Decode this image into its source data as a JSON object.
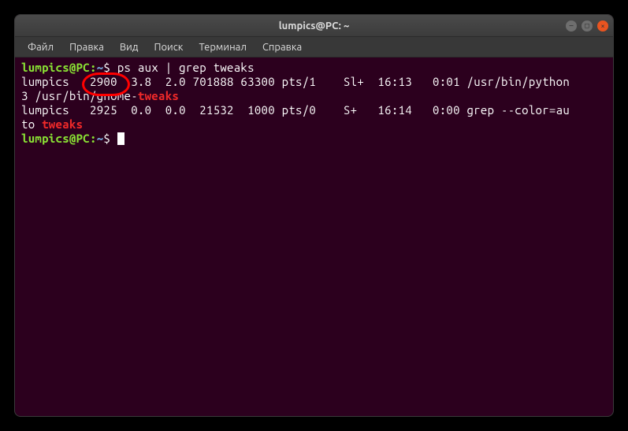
{
  "window": {
    "title": "lumpics@PC: ~"
  },
  "menubar": {
    "items": [
      "Файл",
      "Правка",
      "Вид",
      "Поиск",
      "Терминал",
      "Справка"
    ]
  },
  "prompt": {
    "user_host": "lumpics@PC",
    "separator": ":",
    "path": "~",
    "dollar": "$"
  },
  "command1": "ps aux | grep tweaks",
  "output": {
    "line1": {
      "user": "lumpics",
      "pid": "2900",
      "rest1": "  3.8  2.0 701888 63300 pts/1    Sl+  16:13   0:01 /usr/bin/python",
      "wrap": "3 /usr/bin/gnome-",
      "highlight1": "tweaks"
    },
    "line2": {
      "user": "lumpics",
      "pid": "2925",
      "rest": "  0.0  0.0  21532  1000 pts/0    S+   16:14   0:00 grep --color=au",
      "wrap": "to ",
      "highlight": "tweaks"
    }
  }
}
